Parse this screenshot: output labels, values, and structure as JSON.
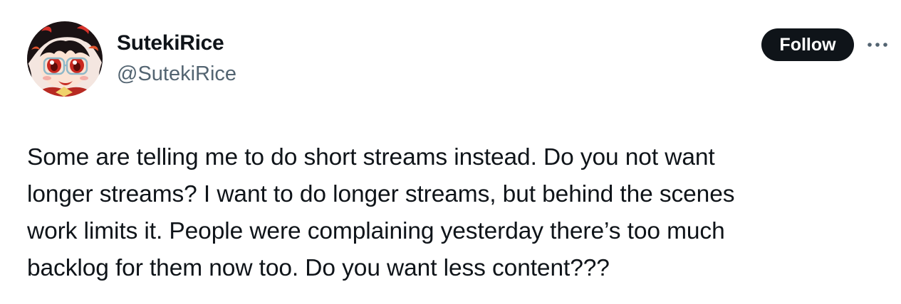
{
  "author": {
    "display_name": "SutekiRice",
    "handle": "@SutekiRice"
  },
  "actions": {
    "follow_label": "Follow",
    "more_icon": "ellipsis-icon"
  },
  "tweet": {
    "lines": [
      "Some are telling me to do short streams instead. Do you not want",
      "longer streams? I want to do longer streams, but behind the scenes",
      "work limits it. People were complaining yesterday there’s too much",
      "backlog for them now too. Do you want less content???"
    ]
  },
  "colors": {
    "text_primary": "#0f1419",
    "text_secondary": "#536471",
    "follow_button_bg": "#0f1419",
    "follow_button_text": "#ffffff",
    "background": "#ffffff"
  }
}
